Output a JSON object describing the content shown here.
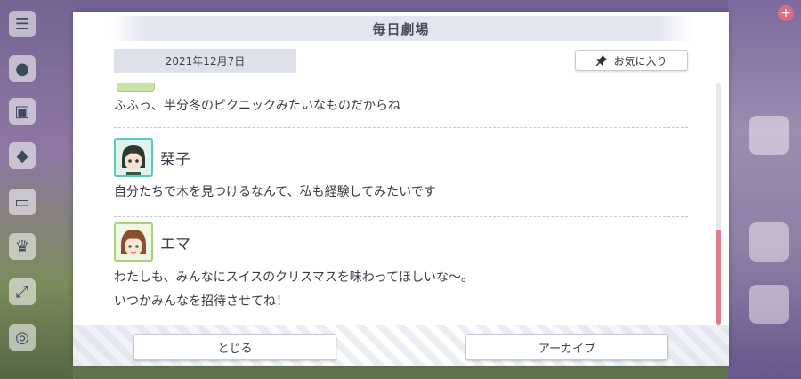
{
  "dialog": {
    "title": "毎日劇場",
    "date": "2021年12月7日",
    "favorite_label": "お気に入り"
  },
  "messages": [
    {
      "text": "ふふっ、半分冬のピクニックみたいなものだからね"
    },
    {
      "speaker": "栞子",
      "text": "自分たちで木を見つけるなんて、私も経験してみたいです"
    },
    {
      "speaker": "エマ",
      "lines": [
        "わたしも、みんなにスイスのクリスマスを味わってほしいな〜。",
        "いつかみんなを招待させてね！"
      ]
    }
  ],
  "buttons": {
    "close_label": "とじる",
    "archive_label": "アーカイブ"
  },
  "colors": {
    "accent_scroll": "#e07f8c",
    "title_bar": "#e4e6ef",
    "text": "#3a3d48"
  }
}
